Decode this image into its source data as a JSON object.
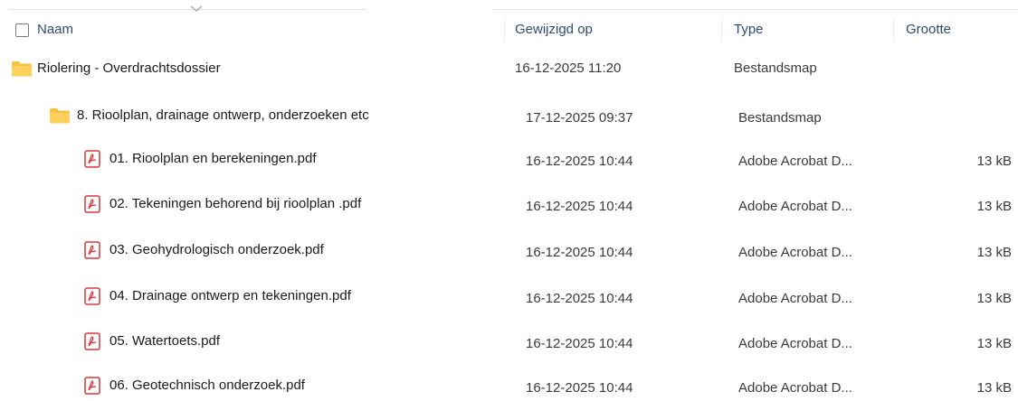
{
  "columns": {
    "name": "Naam",
    "modified": "Gewijzigd op",
    "type": "Type",
    "size": "Grootte"
  },
  "rows": [
    {
      "name": "Riolering - Overdrachtsdossier",
      "modified": "16-12-2025 11:20",
      "type": "Bestandsmap",
      "size": "",
      "icon": "folder-icon"
    },
    {
      "name": "8. Rioolplan, drainage ontwerp, onderzoeken etc",
      "modified": "17-12-2025 09:37",
      "type": "Bestandsmap",
      "size": "",
      "icon": "folder-icon"
    },
    {
      "name": "01. Rioolplan en berekeningen.pdf",
      "modified": "16-12-2025 10:44",
      "type": "Adobe Acrobat D...",
      "size": "13 kB",
      "icon": "pdf-icon"
    },
    {
      "name": "02. Tekeningen behorend bij rioolplan .pdf",
      "modified": "16-12-2025 10:44",
      "type": "Adobe Acrobat D...",
      "size": "13 kB",
      "icon": "pdf-icon"
    },
    {
      "name": "03. Geohydrologisch onderzoek.pdf",
      "modified": "16-12-2025 10:44",
      "type": "Adobe Acrobat D...",
      "size": "13 kB",
      "icon": "pdf-icon"
    },
    {
      "name": "04. Drainage ontwerp en tekeningen.pdf",
      "modified": "16-12-2025 10:44",
      "type": "Adobe Acrobat D...",
      "size": "13 kB",
      "icon": "pdf-icon"
    },
    {
      "name": "05. Watertoets.pdf",
      "modified": "16-12-2025 10:44",
      "type": "Adobe Acrobat D...",
      "size": "13 kB",
      "icon": "pdf-icon"
    },
    {
      "name": "06. Geotechnisch onderzoek.pdf",
      "modified": "16-12-2025 10:44",
      "type": "Adobe Acrobat D...",
      "size": "13 kB",
      "icon": "pdf-icon"
    }
  ],
  "colors": {
    "folder": "#F5C242",
    "pdf": "#D9373B",
    "header_text": "#2E4A70"
  }
}
